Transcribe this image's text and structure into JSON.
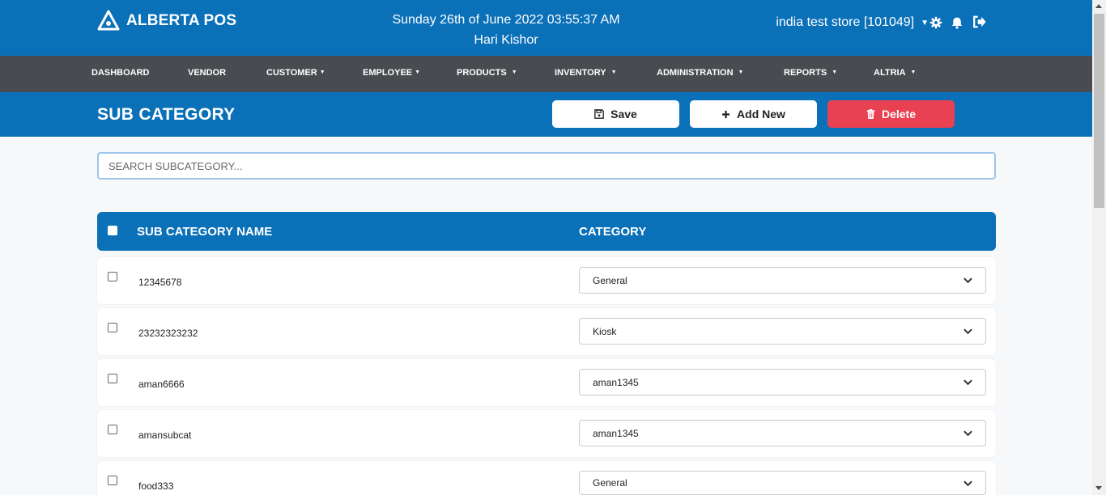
{
  "header": {
    "brand": "ALBERTA POS",
    "date_line": "Sunday 26th of June 2022 03:55:37 AM",
    "user_name": "Hari Kishor",
    "store": "india test store [101049]"
  },
  "nav": {
    "items": [
      {
        "label": "DASHBOARD",
        "dropdown": false
      },
      {
        "label": "VENDOR",
        "dropdown": false
      },
      {
        "label": "CUSTOMER",
        "dropdown": true
      },
      {
        "label": "EMPLOYEE",
        "dropdown": true
      },
      {
        "label": "PRODUCTS",
        "dropdown": true
      },
      {
        "label": "INVENTORY",
        "dropdown": true
      },
      {
        "label": "ADMINISTRATION",
        "dropdown": true
      },
      {
        "label": "REPORTS",
        "dropdown": true
      },
      {
        "label": "ALTRIA",
        "dropdown": true
      }
    ]
  },
  "page": {
    "title": "SUB CATEGORY",
    "save_label": "Save",
    "add_label": "Add New",
    "delete_label": "Delete"
  },
  "search": {
    "placeholder": "SEARCH SUBCATEGORY...",
    "value": ""
  },
  "table": {
    "columns": [
      "SUB CATEGORY NAME",
      "CATEGORY"
    ],
    "rows": [
      {
        "name": "12345678",
        "category": "General"
      },
      {
        "name": "23232323232",
        "category": "Kiosk"
      },
      {
        "name": "aman6666",
        "category": "aman1345"
      },
      {
        "name": "amansubcat",
        "category": "aman1345"
      },
      {
        "name": "food333",
        "category": "General"
      }
    ]
  },
  "colors": {
    "primary": "#0a70b8",
    "nav_bg": "#484b4f",
    "danger": "#e84152"
  },
  "icons": {
    "brand": "alberta-logo-icon",
    "settings": "gear-icon",
    "notifications": "bell-icon",
    "logout": "logout-icon",
    "save": "floppy-disk-icon",
    "add": "plus-icon",
    "delete": "trash-icon"
  }
}
